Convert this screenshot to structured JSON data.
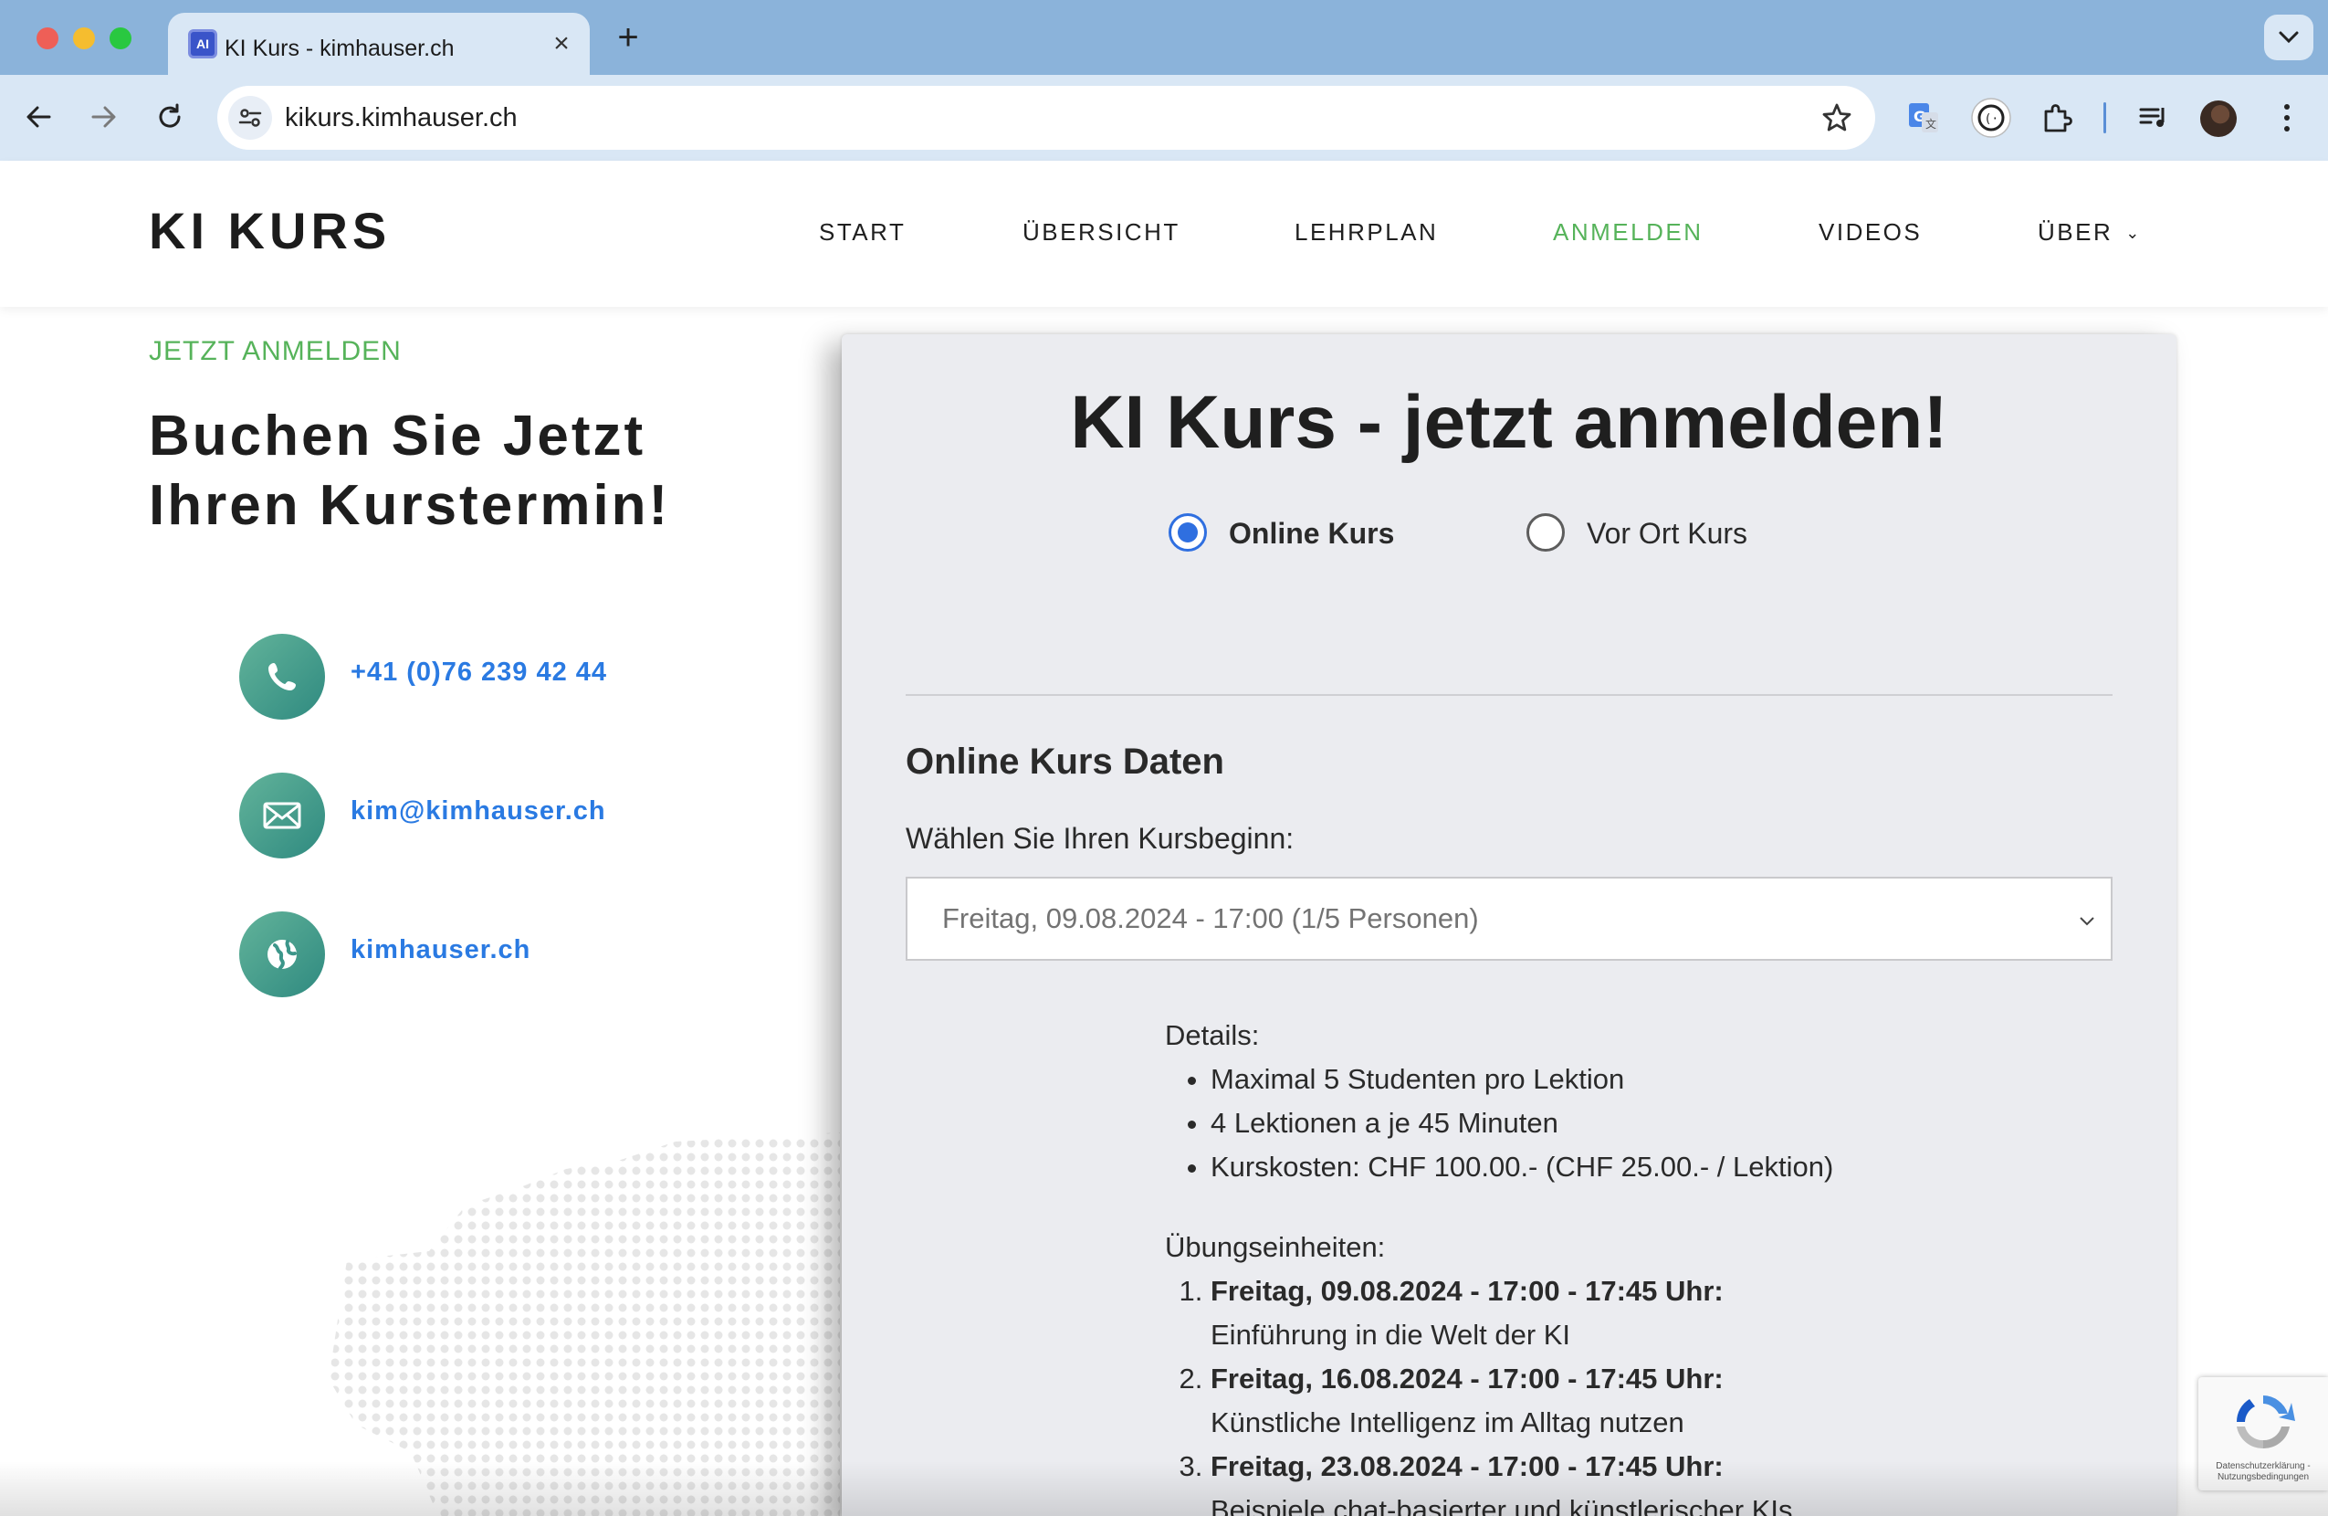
{
  "browser": {
    "tab_title": "KI Kurs - kimhauser.ch",
    "tab_favicon_text": "AI",
    "url": "kikurs.kimhauser.ch",
    "icons": [
      "back-icon",
      "forward-icon",
      "reload-icon",
      "site-settings-icon",
      "bookmark-star-icon",
      "google-translate-icon",
      "extension-icon",
      "extensions-puzzle-icon",
      "media-queue-icon",
      "profile-avatar",
      "kebab-menu-icon"
    ]
  },
  "site": {
    "logo": "KI KURS",
    "nav": [
      {
        "label": "START"
      },
      {
        "label": "ÜBERSICHT"
      },
      {
        "label": "LEHRPLAN"
      },
      {
        "label": "ANMELDEN",
        "active": true
      },
      {
        "label": "VIDEOS"
      },
      {
        "label": "ÜBER"
      }
    ],
    "accent_color": "#56b35a",
    "link_color": "#2a7ae2"
  },
  "left": {
    "eyebrow": "JETZT ANMELDEN",
    "headline_line1": "Buchen Sie Jetzt",
    "headline_line2": "Ihren Kurstermin!",
    "contacts": [
      {
        "icon": "phone-icon",
        "text": "+41 (0)76 239 42 44"
      },
      {
        "icon": "mail-icon",
        "text": "kim@kimhauser.ch"
      },
      {
        "icon": "globe-icon",
        "text": "kimhauser.ch"
      }
    ]
  },
  "form": {
    "title": "KI Kurs - jetzt anmelden!",
    "radios": [
      {
        "label": "Online Kurs",
        "checked": true
      },
      {
        "label": "Vor Ort Kurs",
        "checked": false
      }
    ],
    "section_heading": "Online Kurs Daten",
    "select_label": "Wählen Sie Ihren Kursbeginn:",
    "select_value": "Freitag, 09.08.2024 - 17:00 (1/5 Personen)",
    "details_heading": "Details:",
    "details": [
      "Maximal 5 Studenten pro Lektion",
      "4 Lektionen a je 45 Minuten",
      "Kurskosten: CHF 100.00.- (CHF 25.00.- / Lektion)"
    ],
    "units_heading": "Übungseinheiten:",
    "units": [
      {
        "when": "Freitag, 09.08.2024 - 17:00 - 17:45 Uhr:",
        "topic": "Einführung in die Welt der KI"
      },
      {
        "when": "Freitag, 16.08.2024 - 17:00 - 17:45 Uhr:",
        "topic": "Künstliche Intelligenz im Alltag nutzen"
      },
      {
        "when": "Freitag, 23.08.2024 - 17:00 - 17:45 Uhr:",
        "topic": "Beispiele chat-basierter und künstlerischer KIs"
      }
    ]
  },
  "recaptcha": {
    "text": "Datenschutzerklärung - Nutzungsbedingungen"
  }
}
